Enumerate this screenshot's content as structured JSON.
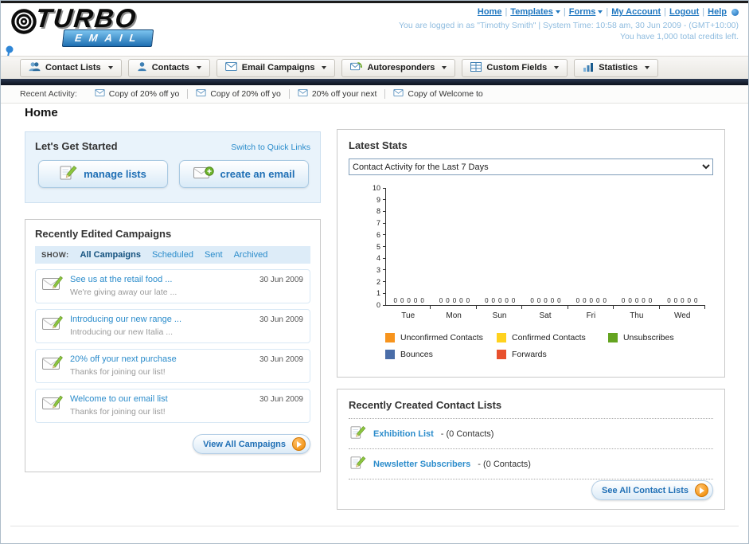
{
  "page": {
    "title": "Home"
  },
  "header": {
    "logo": {
      "line1": "TURBO",
      "line2": "EMAIL"
    },
    "nav_links": [
      {
        "label": "Home",
        "dropdown": false
      },
      {
        "label": "Templates",
        "dropdown": true
      },
      {
        "label": "Forms",
        "dropdown": true
      },
      {
        "label": "My Account",
        "dropdown": false
      },
      {
        "label": "Logout",
        "dropdown": false
      },
      {
        "label": "Help",
        "dropdown": false
      }
    ],
    "login_info": "You are logged in as \"Timothy Smith\" | System Time: 10:58 am, 30 Jun 2009 - (GMT+10:00)",
    "credits_info": "You have 1,000 total credits left."
  },
  "nav": {
    "tabs": [
      {
        "label": "Contact Lists",
        "icon": "people-icon"
      },
      {
        "label": "Contacts",
        "icon": "person-icon"
      },
      {
        "label": "Email Campaigns",
        "icon": "envelope-icon"
      },
      {
        "label": "Autoresponders",
        "icon": "envelope-arrow-icon"
      },
      {
        "label": "Custom Fields",
        "icon": "grid-icon"
      },
      {
        "label": "Statistics",
        "icon": "bar-chart-icon"
      }
    ]
  },
  "recent_activity": {
    "label": "Recent Activity:",
    "items": [
      "Copy of 20% off yo",
      "Copy of 20% off yo",
      "20% off your next",
      "Copy of Welcome to"
    ]
  },
  "get_started": {
    "title": "Let's Get Started",
    "switch_link": "Switch to Quick Links",
    "manage_lists_label": "manage lists",
    "create_email_label": "create an email"
  },
  "campaigns": {
    "title": "Recently Edited Campaigns",
    "show_label": "SHOW:",
    "tabs": [
      "All Campaigns",
      "Scheduled",
      "Sent",
      "Archived"
    ],
    "active_tab": "All Campaigns",
    "items": [
      {
        "title": "See us at the retail food ...",
        "subtitle": "We're giving away our late ...",
        "date": "30 Jun 2009"
      },
      {
        "title": "Introducing our new range ...",
        "subtitle": "Introducing our new Italia ...",
        "date": "30 Jun 2009"
      },
      {
        "title": "20% off your next purchase",
        "subtitle": "Thanks for joining our list!",
        "date": "30 Jun 2009"
      },
      {
        "title": "Welcome to our email list",
        "subtitle": "Thanks for joining our list!",
        "date": "30 Jun 2009"
      }
    ],
    "view_all_label": "View All Campaigns"
  },
  "stats": {
    "title": "Latest Stats",
    "dropdown_value": "Contact Activity for the Last 7 Days",
    "chart_data": {
      "type": "bar",
      "categories": [
        "Tue",
        "Mon",
        "Sun",
        "Sat",
        "Fri",
        "Thu",
        "Wed"
      ],
      "series": [
        {
          "name": "Unconfirmed Contacts",
          "color": "#f7941d",
          "values": [
            0,
            0,
            0,
            0,
            0,
            0,
            0
          ]
        },
        {
          "name": "Confirmed Contacts",
          "color": "#ffd21e",
          "values": [
            0,
            0,
            0,
            0,
            0,
            0,
            0
          ]
        },
        {
          "name": "Unsubscribes",
          "color": "#64a420",
          "values": [
            0,
            0,
            0,
            0,
            0,
            0,
            0
          ]
        },
        {
          "name": "Bounces",
          "color": "#4a6da8",
          "values": [
            0,
            0,
            0,
            0,
            0,
            0,
            0
          ]
        },
        {
          "name": "Forwards",
          "color": "#e8502d",
          "values": [
            0,
            0,
            0,
            0,
            0,
            0,
            0
          ]
        }
      ],
      "title": "Contact Activity for the Last 7 Days",
      "xlabel": "",
      "ylabel": "",
      "ylim": [
        0,
        10
      ],
      "ytick_step": 1,
      "grid": false,
      "legend_position": "bottom",
      "data_labels": true
    }
  },
  "contact_lists": {
    "title": "Recently Created Contact Lists",
    "items": [
      {
        "name": "Exhibition List",
        "detail": "- (0 Contacts)"
      },
      {
        "name": "Newsletter Subscribers",
        "detail": "- (0 Contacts)"
      }
    ],
    "see_all_label": "See All Contact Lists"
  }
}
